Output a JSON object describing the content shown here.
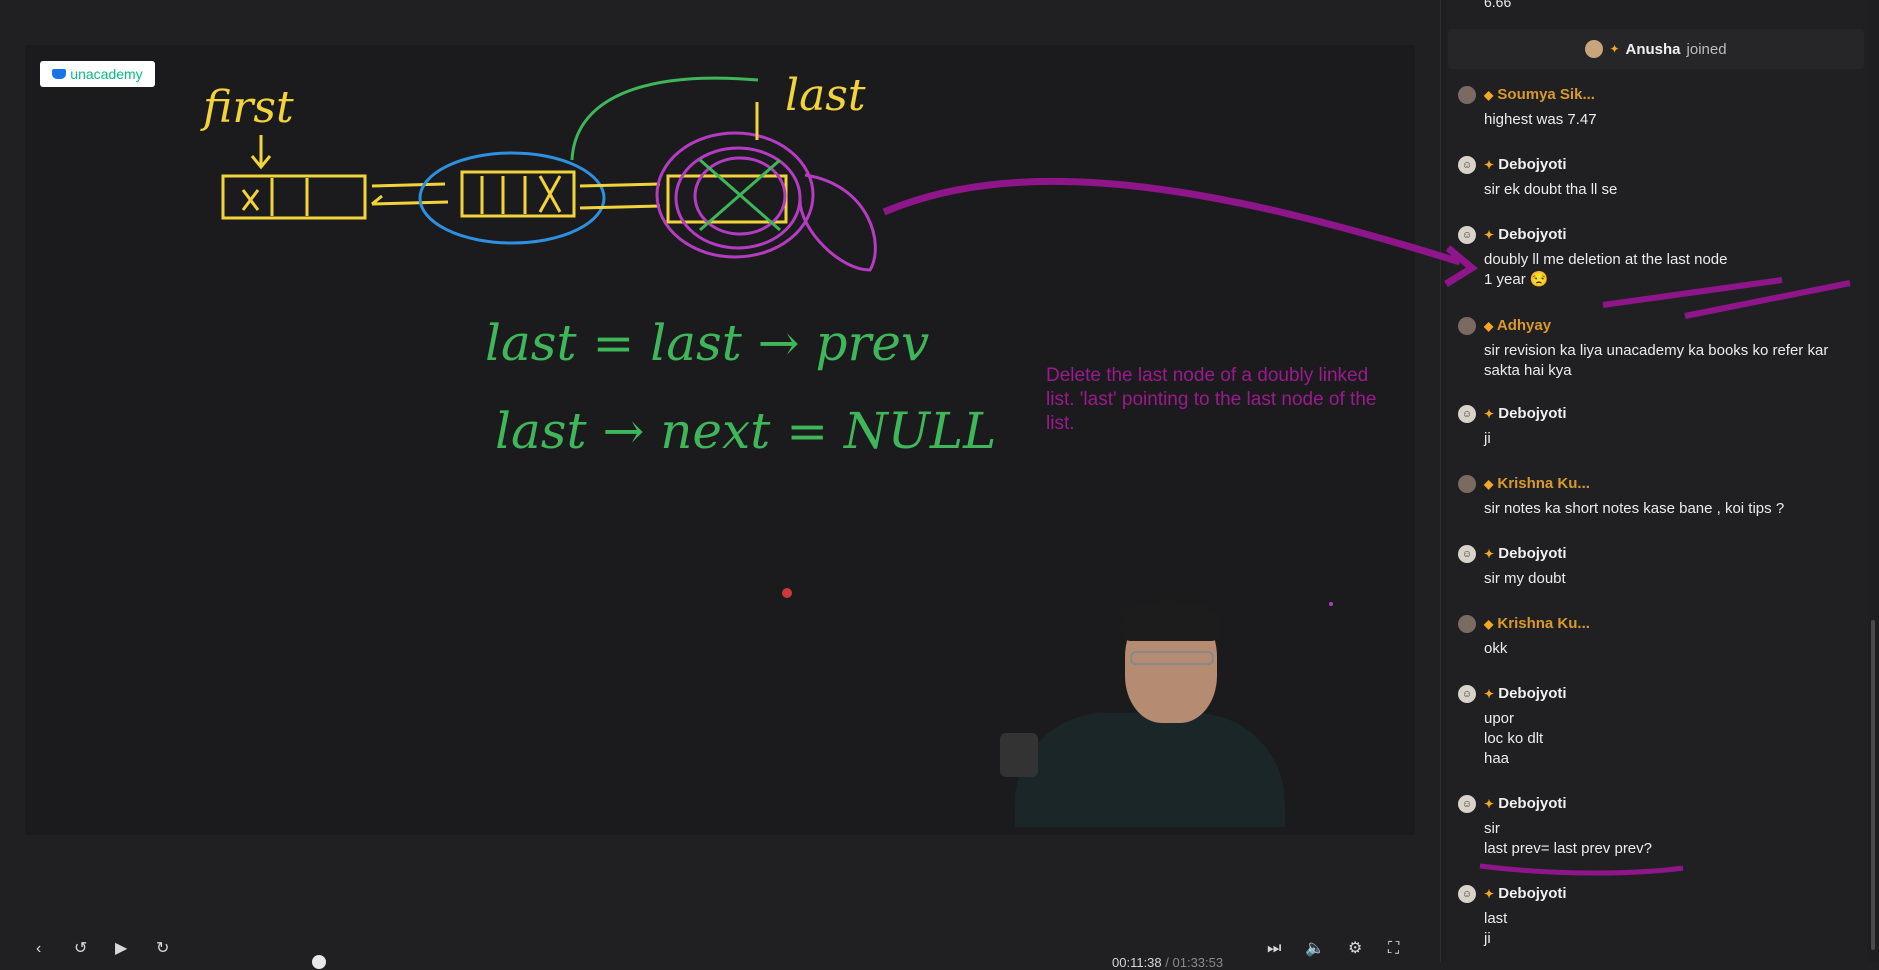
{
  "brand": {
    "logo_text": "unacademy"
  },
  "board": {
    "label_first": "first",
    "label_last": "last",
    "eq1": "last = last → prev",
    "eq2": "last → next = NULL",
    "note": "Delete the last node of a doubly linked list. 'last' pointing to the last node of the list."
  },
  "controls": {
    "time_current": "00:11:38",
    "time_total": "01:33:53"
  },
  "chat": {
    "top_value": "6.66",
    "joined": {
      "name": "Anusha",
      "suffix": "joined"
    },
    "messages": [
      {
        "name": "Soumya Sik...",
        "role": "mod",
        "text": "highest was 7.47"
      },
      {
        "name": "Debojyoti",
        "role": "user",
        "text": "sir ek doubt tha ll se"
      },
      {
        "name": "Debojyoti",
        "role": "user",
        "text": "doubly ll me deletion  at the last node\n1 year 😒"
      },
      {
        "name": "Adhyay",
        "role": "mod",
        "text": "sir revision ka liya unacademy ka books ko refer kar sakta hai kya"
      },
      {
        "name": "Debojyoti",
        "role": "user",
        "text": "ji"
      },
      {
        "name": "Krishna Ku...",
        "role": "mod",
        "text": "sir notes ka short notes kase bane , koi tips ?"
      },
      {
        "name": "Debojyoti",
        "role": "user",
        "text": "sir my doubt"
      },
      {
        "name": "Krishna Ku...",
        "role": "mod",
        "text": "okk"
      },
      {
        "name": "Debojyoti",
        "role": "user",
        "text": "upor\nloc ko dlt\nhaa"
      },
      {
        "name": "Debojyoti",
        "role": "user",
        "text": "sir\nlast prev= last prev prev?"
      },
      {
        "name": "Debojyoti",
        "role": "user",
        "text": "last\nji"
      }
    ]
  }
}
